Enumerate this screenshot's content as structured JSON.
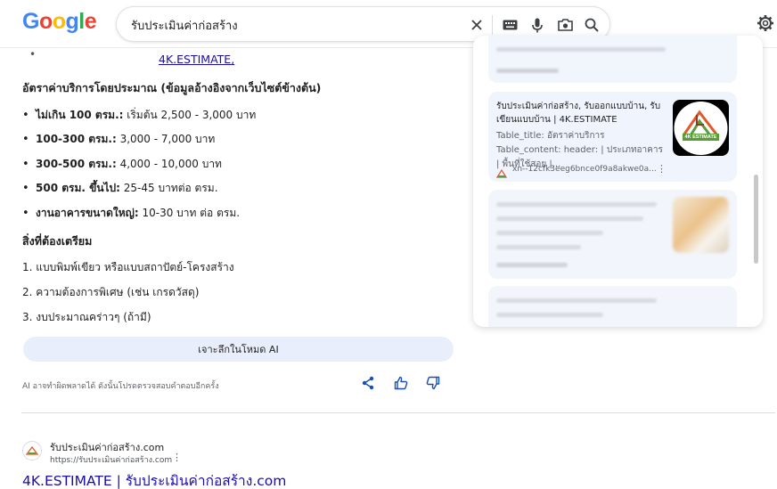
{
  "search": {
    "query": "รับประเมินค่าก่อสร้าง"
  },
  "logo": {
    "letters": [
      "G",
      "o",
      "o",
      "g",
      "l",
      "e"
    ],
    "colors": [
      "#4285F4",
      "#EA4335",
      "#FBBC05",
      "#4285F4",
      "#34A853",
      "#EA4335"
    ]
  },
  "icons": {
    "clear": "close-icon",
    "keyboard": "keyboard-icon",
    "voice": "microphone-icon",
    "lens": "camera-lens-icon",
    "search": "search-icon",
    "settings": "gear-icon"
  },
  "overview": {
    "top_link": "4K.ESTIMATE",
    "top_link_suffix": ",",
    "rates_heading": "อัตราค่าบริการโดยประมาณ (ข้อมูลอ้างอิงจากเว็บไซต์ข้างต้น)",
    "rates": [
      {
        "label": "ไม่เกิน 100 ตรม.:",
        "text": " เริ่มต้น 2,500 - 3,000 บาท"
      },
      {
        "label": "100-300 ตรม.:",
        "text": " 3,000 - 7,000 บาท"
      },
      {
        "label": "300-500 ตรม.:",
        "text": " 4,000 - 10,000 บาท"
      },
      {
        "label": "500 ตรม. ขึ้นไป:",
        "text": " 25-45 บาทต่อ ตรม."
      },
      {
        "label": "งานอาคารขนาดใหญ่:",
        "text": " 10-30 บาท ต่อ ตรม."
      }
    ],
    "prep_heading": "สิ่งที่ต้องเตรียม",
    "prep": [
      "1. แบบพิมพ์เขียว หรือแบบสถาปัตย์-โครงสร้าง",
      "2. ความต้องการพิเศษ (เช่น เกรดวัสดุ)",
      "3. งบประมาณคร่าวๆ (ถ้ามี)"
    ],
    "dive_button": "เจาะลึกในโหมด AI",
    "disclaimer": "AI อาจทำผิดพลาดได้ ดังนั้นโปรดตรวจสอบคำตอบอีกครั้ง",
    "actions": [
      "share-icon",
      "thumbs-up-icon",
      "thumbs-down-icon"
    ]
  },
  "side_panel": {
    "card": {
      "title": "รับประเมินค่าก่อสร้าง, รับออกแบบบ้าน, รับเขียนแบบบ้าน | 4K.ESTIMATE",
      "desc": "Table_title: อัตราค่าบริการ Table_content: header: | ประเภทอาคาร | พื้นที่ใช้สอย |...",
      "source": "xn--12cfk3eeg6bnce0f9a8akwe0a...",
      "thumb_text": "4K ESTIMATE"
    }
  },
  "result": {
    "site_name": "รับประเมินค่าก่อสร้าง.com",
    "site_url": "https://รับประเมินค่าก่อสร้าง.com",
    "title": "4K.ESTIMATE | รับประเมินค่าก่อสร้าง.com"
  }
}
